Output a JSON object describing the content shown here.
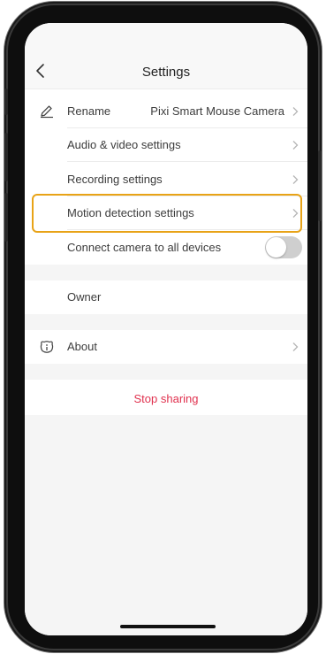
{
  "header": {
    "title": "Settings"
  },
  "rows": [
    {
      "label": "Rename",
      "value": "Pixi Smart Mouse Camera",
      "icon": "pencil-icon"
    },
    {
      "label": "Audio & video settings"
    },
    {
      "label": "Recording settings"
    },
    {
      "label": "Motion detection settings",
      "highlighted": true
    },
    {
      "label": "Connect camera to all devices",
      "toggle": "off"
    }
  ],
  "owner": {
    "label": "Owner"
  },
  "about": {
    "label": "About",
    "icon": "info-icon"
  },
  "actions": {
    "stop_sharing": "Stop sharing"
  },
  "colors": {
    "highlight": "#e8a317",
    "danger": "#e0314e",
    "toggle_off": "#cfcfcf"
  }
}
